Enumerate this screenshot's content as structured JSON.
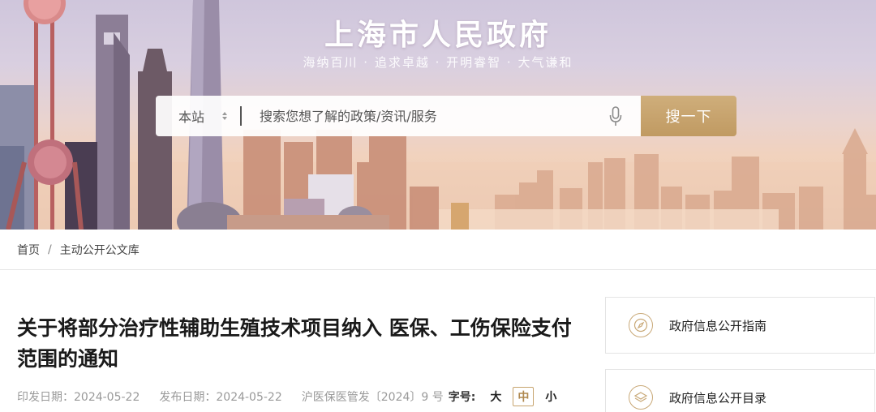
{
  "header": {
    "site_title": "上海市人民政府",
    "slogan": "海纳百川 · 追求卓越 · 开明睿智 · 大气谦和"
  },
  "search": {
    "scope_label": "本站",
    "placeholder": "搜索您想了解的政策/资讯/服务",
    "button_label": "搜一下",
    "mic_icon": "microphone-icon"
  },
  "breadcrumb": {
    "home": "首页",
    "separator": "/",
    "current": "主动公开公文库"
  },
  "article": {
    "title": "关于将部分治疗性辅助生殖技术项目纳入 医保、工伤保险支付范围的通知",
    "print_date": "印发日期：2024-05-22",
    "publish_date": "发布日期：2024-05-22",
    "doc_number": "沪医保医管发〔2024〕9 号",
    "font_size_label": "字号:",
    "font_sizes": [
      "大",
      "中",
      "小"
    ],
    "font_size_selected": "中"
  },
  "sidebar": {
    "items": [
      {
        "label": "政府信息公开指南",
        "icon": "compass-icon"
      },
      {
        "label": "政府信息公开目录",
        "icon": "layers-icon"
      }
    ]
  },
  "colors": {
    "accent_gold": "#c09a62",
    "active_border": "#c7a46e"
  }
}
